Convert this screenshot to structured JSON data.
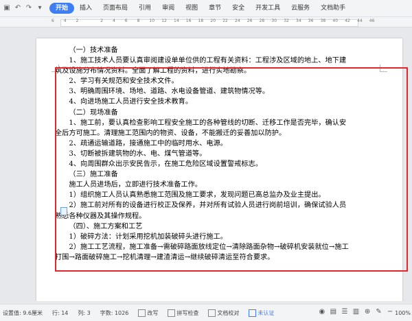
{
  "ribbon": {
    "tabs": [
      "开始",
      "插入",
      "页面布局",
      "引用",
      "审阅",
      "视图",
      "章节",
      "安全",
      "开发工具",
      "云服务",
      "文档助手"
    ],
    "active_tab": "开始"
  },
  "ruler": {
    "ticks": [
      "6",
      "4",
      "2",
      "",
      "2",
      "4",
      "6",
      "8",
      "10",
      "12",
      "14",
      "16",
      "18",
      "20",
      "22",
      "24",
      "26",
      "28",
      "30",
      "32",
      "34",
      "36",
      "38",
      "40",
      "42",
      "44",
      "46"
    ]
  },
  "document": {
    "paragraphs": [
      {
        "text": "（一）技术准备",
        "style": "h1"
      },
      {
        "text": "1、施工技术人员要认真审阅建设单单位供的工程有关资料：工程涉及区域的地上、地下建筑及设施分布情况资料。全面了解工程的资料，进行实地勘察。",
        "style": "ind"
      },
      {
        "text": "2、学习有关规范和安全技术文件。",
        "style": "ind"
      },
      {
        "text": "3、明确周围环境、场地、道路、水电设备管道、建筑物情况等。",
        "style": "ind"
      },
      {
        "text": "4、向进场施工人员进行安全技术教育。",
        "style": "ind"
      },
      {
        "text": "（二）现场准备",
        "style": "h1"
      },
      {
        "text": "1、施工前，要认真检查影响工程安全施工的各种管线的切断、迁移工作是否完毕，确认安全后方可施工。清理施工范围内的物资、设备，不能搬迁的妥善加以防护。",
        "style": "ind"
      },
      {
        "text": "2、疏通运输道路，接通施工中的临时用水、电源。",
        "style": "ind"
      },
      {
        "text": "3、切断被拆建筑物的水、电、煤气管道等。",
        "style": "ind"
      },
      {
        "text": "4、向周围群众出示安民告示，在施工危险区域设置警戒标志。",
        "style": "ind"
      },
      {
        "text": "（三）施工准备",
        "style": "h1"
      },
      {
        "text": "施工人员进场后，立即进行技术准备工作。",
        "style": "ind"
      },
      {
        "text": "1）组织施工人员认真熟悉施工范围及施工要求，发现问题已高总监办及业主提出。",
        "style": "ind"
      },
      {
        "text": "2）施工前对所有的设备进行校正及保养，并对所有试验人员进行岗前培训，确保试验人员熟悉各种仪器及其操作规程。",
        "style": "ind"
      },
      {
        "text": "（四）、施工方案和工艺",
        "style": "h1"
      },
      {
        "text": "1）破碎方法：计划采用挖机加装破碎头进行施工。",
        "style": "ind"
      },
      {
        "text": "2）施工工艺流程，施工准备→需破碎路面放线定位→清除路面杂物→破碎机安装就位→施工打围→路面破碎施工→挖机清理→建渣清运→继续破碎清运至符合要求。",
        "style": "ind"
      }
    ]
  },
  "status_bar": {
    "position": "设置值: 9.6厘米",
    "line": "行: 14",
    "column": "列: 3",
    "word_count": "字数: 1026",
    "revision": "改写",
    "spell_check": "拼写检查",
    "doc_check": "文档校对",
    "cert": "未认证",
    "zoom": "100%"
  },
  "colors": {
    "accent": "#3d7ef5",
    "highlight_border": "#e3262b"
  }
}
